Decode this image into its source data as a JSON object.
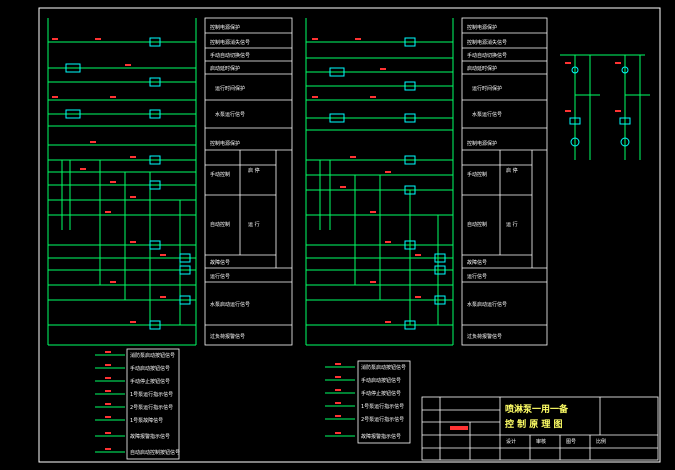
{
  "colors": {
    "background": "#000000",
    "frame": "#ffffff",
    "wire": "#00ff66",
    "component": "#00ffff",
    "tag": "#ff3333",
    "title_text": "#ffff66"
  },
  "left_panel": {
    "top_rows": [
      "控制电源保护",
      "控制电源消失信号",
      "手动自动切换信号",
      "启动延时保护",
      "运行时间保护",
      "水泵运行信号"
    ],
    "mid_header": "控制电源保护",
    "mid_rows": [
      "手动控制",
      "启 停",
      "自动控制",
      "运 行",
      "故障信号",
      "运行信号"
    ],
    "bottom_rows": [
      "水泵启动运行信号",
      "过负荷报警信号"
    ]
  },
  "right_panel": {
    "top_rows": [
      "控制电源保护",
      "控制电源消失信号",
      "手动自动切换信号",
      "启动延时保护",
      "运行时间保护",
      "水泵运行信号"
    ],
    "mid_header": "控制电源保护",
    "mid_rows": [
      "手动控制",
      "启 停",
      "自动控制",
      "运 行",
      "故障信号",
      "运行信号"
    ],
    "bottom_rows": [
      "水泵启动运行信号",
      "过负荷报警信号"
    ]
  },
  "legend_left": [
    "消防泵启动按钮信号",
    "手动启动按钮信号",
    "手动停止按钮信号",
    "1号泵运行指示信号",
    "2号泵运行指示信号",
    "1号泵故障信号",
    "故障报警指示信号",
    "自动启动控制按钮信号"
  ],
  "legend_right": [
    "消防泵启动按钮信号",
    "手动启动按钮信号",
    "手动停止按钮信号",
    "1号泵运行指示信号",
    "2号泵运行指示信号",
    "故障报警指示信号"
  ],
  "title_block": {
    "title_line1": "喷淋泵一用一备",
    "title_line2": "控 制 原 理 图",
    "cells": [
      "设计",
      "审核",
      "图号",
      "比例"
    ]
  }
}
